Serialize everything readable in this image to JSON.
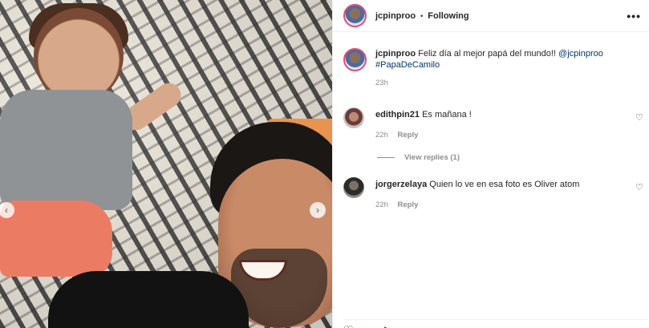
{
  "post": {
    "username": "jcpinproo",
    "follow_status": "Following",
    "caption_prefix": "Feliz día al mejor papá del mundo!! ",
    "caption_mention": "@jcpinproo",
    "caption_hashtag": "#PapaDeCamilo",
    "caption_time": "23h"
  },
  "comments": [
    {
      "username": "edithpin21",
      "text": "Es mañana !",
      "time": "22h",
      "reply_label": "Reply",
      "view_replies": "View replies (1)"
    },
    {
      "username": "jorgerzelaya",
      "text": "Quien lo ve en esa foto es Oliver atom",
      "time": "22h",
      "reply_label": "Reply"
    }
  ],
  "icons": {
    "more": "more-options-icon",
    "prev": "chevron-left-icon",
    "next": "chevron-right-icon",
    "like": "heart-icon",
    "comment": "comment-icon",
    "share": "share-icon"
  },
  "colors": {
    "link": "#00376b",
    "muted": "#8e8e8e",
    "story_ring": "#e04d78"
  }
}
